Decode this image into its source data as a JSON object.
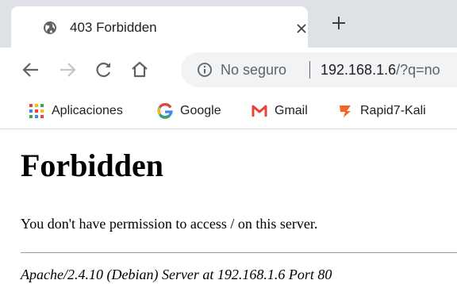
{
  "browser": {
    "tab": {
      "title": "403 Forbidden",
      "favicon": "globe-icon",
      "close_icon": "close-icon"
    },
    "new_tab_icon": "plus-icon",
    "toolbar": {
      "back_icon": "back-arrow-icon",
      "forward_icon": "forward-arrow-icon",
      "reload_icon": "reload-icon",
      "home_icon": "home-icon",
      "security_icon": "info-icon",
      "security_label": "No seguro",
      "url_host": "192.168.1.6",
      "url_query": "/?q=no"
    },
    "bookmarks": [
      {
        "label": "Aplicaciones",
        "icon": "apps-grid-icon"
      },
      {
        "label": "Google",
        "icon": "google-icon"
      },
      {
        "label": "Gmail",
        "icon": "gmail-icon"
      },
      {
        "label": "Rapid7-Kali",
        "icon": "rapid7-icon"
      }
    ]
  },
  "page": {
    "heading": "Forbidden",
    "message": "You don't have permission to access / on this server.",
    "server_signature": "Apache/2.4.10 (Debian) Server at 192.168.1.6 Port 80"
  },
  "colors": {
    "tabstrip_bg": "#dee1e6",
    "omnibox_bg": "#f1f3f4",
    "apps_grid": [
      "#ea4335",
      "#fbbc05",
      "#34a853",
      "#4285f4"
    ],
    "gmail_red": "#ea4335",
    "rapid7_orange": "#f26522"
  }
}
